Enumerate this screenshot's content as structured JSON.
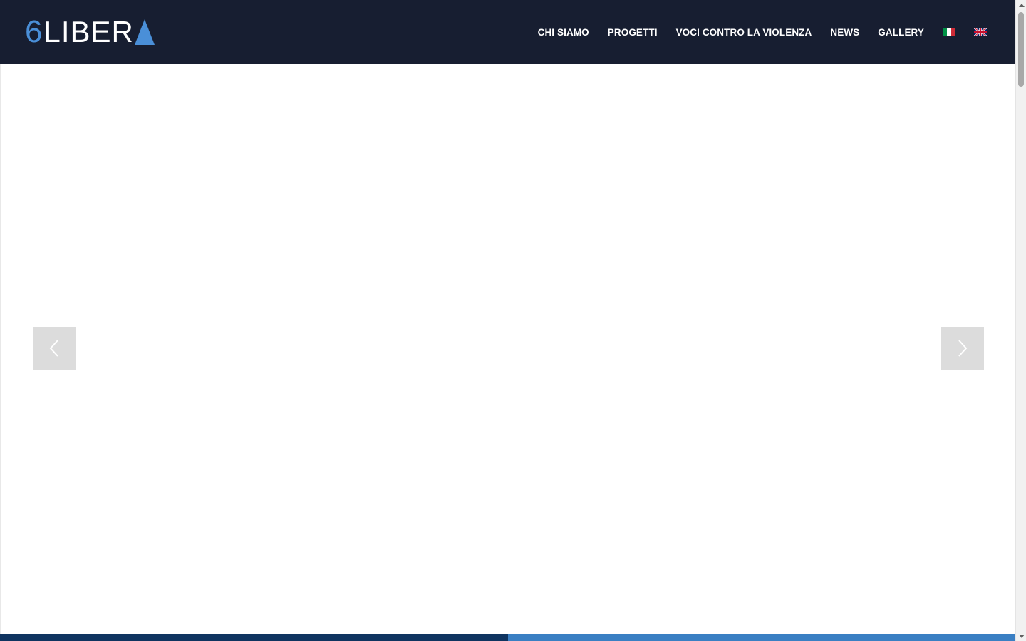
{
  "logo": {
    "six": "6",
    "word": "LIBER",
    "accent_color": "#4a8fd8"
  },
  "nav": {
    "items": [
      {
        "label": "CHI SIAMO"
      },
      {
        "label": "PROGETTI"
      },
      {
        "label": "VOCI CONTRO LA VIOLENZA"
      },
      {
        "label": "NEWS"
      },
      {
        "label": "GALLERY"
      }
    ],
    "languages": [
      {
        "icon": "italian-flag-icon"
      },
      {
        "icon": "uk-flag-icon"
      }
    ]
  },
  "slider": {
    "prev_icon": "chevron-left-icon",
    "next_icon": "chevron-right-icon"
  },
  "colors": {
    "header_bg": "#171e31",
    "bar_dark": "#0f3460",
    "bar_light": "#3a7fc3",
    "arrow_bg": "#dcdcdc"
  }
}
